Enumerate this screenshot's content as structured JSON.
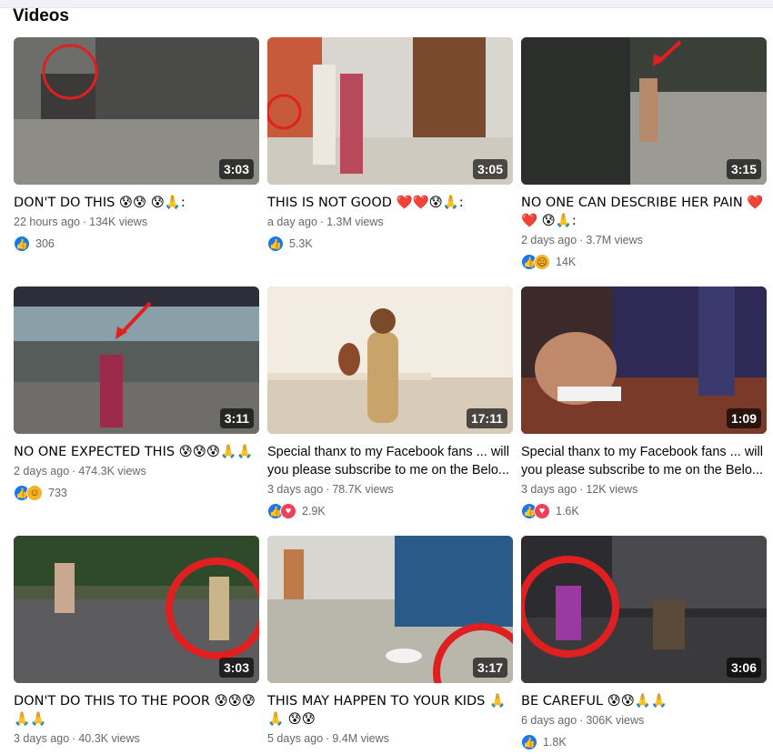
{
  "section_title": "Videos",
  "videos": [
    {
      "title": "DON'T DO THIS 😰😰 😰🙏:",
      "age": "22 hours ago",
      "views": "134K views",
      "reactions": "306",
      "duration": "3:03",
      "icons": [
        "like-icon"
      ]
    },
    {
      "title": "THIS IS NOT GOOD ❤️❤️😰🙏:",
      "age": "a day ago",
      "views": "1.3M views",
      "reactions": "5.3K",
      "duration": "3:05",
      "icons": [
        "like-icon"
      ]
    },
    {
      "title": "NO ONE CAN DESCRIBE HER PAIN ❤️❤️ 😰🙏:",
      "age": "2 days ago",
      "views": "3.7M views",
      "reactions": "14K",
      "duration": "3:15",
      "icons": [
        "like-icon",
        "sad-icon"
      ]
    },
    {
      "title": "NO ONE EXPECTED THIS 😰😰😰🙏🙏",
      "age": "2 days ago",
      "views": "474.3K views",
      "reactions": "733",
      "duration": "3:11",
      "icons": [
        "like-icon",
        "haha-icon"
      ]
    },
    {
      "title": "Special thanx to my Facebook fans ... will you please subscribe to me on the Belo...",
      "age": "3 days ago",
      "views": "78.7K views",
      "reactions": "2.9K",
      "duration": "17:11",
      "icons": [
        "like-icon",
        "love-icon"
      ]
    },
    {
      "title": "Special thanx to my Facebook fans ... will you please subscribe to me on the Belo...",
      "age": "3 days ago",
      "views": "12K views",
      "reactions": "1.6K",
      "duration": "1:09",
      "icons": [
        "like-icon",
        "love-icon"
      ]
    },
    {
      "title": "DON'T DO THIS TO THE POOR 😰😰😰 🙏🙏",
      "age": "3 days ago",
      "views": "40.3K views",
      "reactions": "",
      "duration": "3:03",
      "icons": []
    },
    {
      "title": "THIS MAY HAPPEN TO YOUR KIDS 🙏🙏 😰😰",
      "age": "5 days ago",
      "views": "9.4M views",
      "reactions": "",
      "duration": "3:17",
      "icons": []
    },
    {
      "title": "BE CAREFUL 😰😰🙏🙏",
      "age": "6 days ago",
      "views": "306K views",
      "reactions": "1.8K",
      "duration": "3:06",
      "icons": [
        "like-icon"
      ]
    }
  ]
}
